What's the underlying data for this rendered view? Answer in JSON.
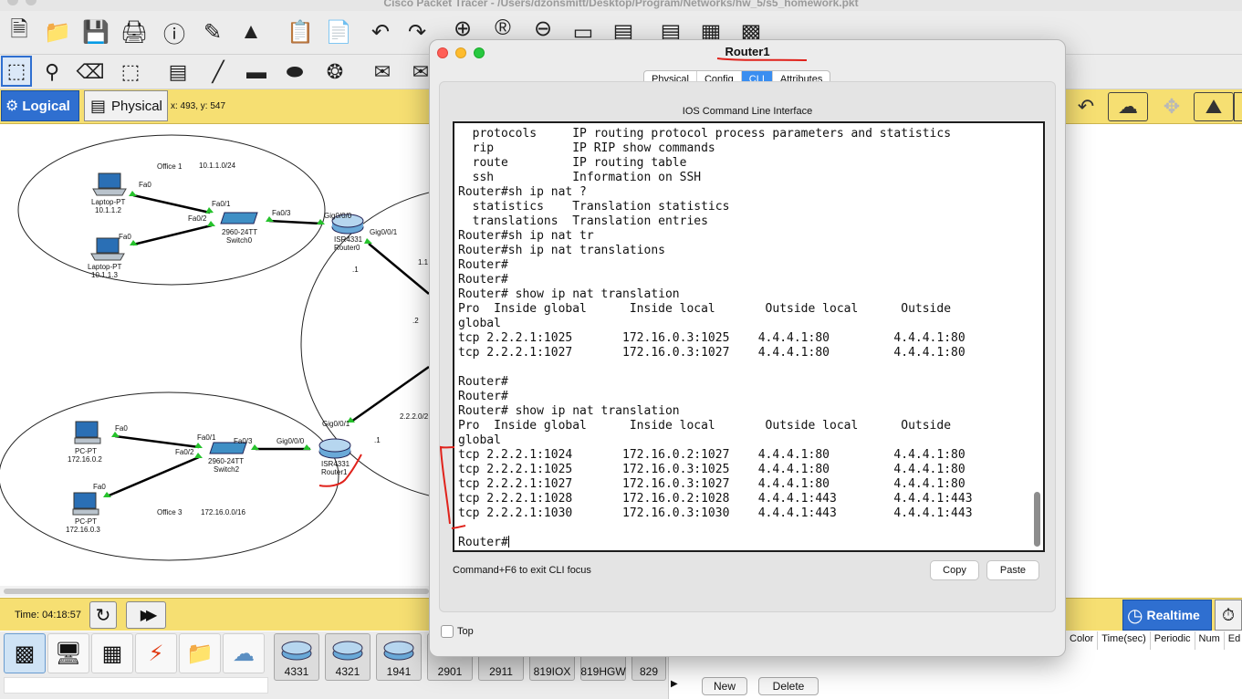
{
  "window": {
    "title": "Cisco Packet Tracer - /Users/dzonsmitt/Desktop/Program/Networks/hw_5/s5_homework.pkt"
  },
  "toolbar": {
    "main_icons": [
      "new-file-icon",
      "open-folder-icon",
      "save-icon",
      "print-icon",
      "info-icon",
      "network-wizard-icon",
      "activity-wizard-icon",
      "copy-icon",
      "paste-icon",
      "undo-icon",
      "redo-icon",
      "zoom-in-icon",
      "zoom-reset-icon",
      "zoom-out-icon",
      "drawing-palette-icon",
      "custom-device-icon",
      "cluster-icon",
      "viewport-icon"
    ],
    "edit_icons": [
      "select-icon",
      "inspect-icon",
      "delete-icon",
      "resize-icon",
      "note-icon",
      "line-icon",
      "rectangle-icon",
      "ellipse-icon",
      "freeform-icon",
      "simple-pdu-icon",
      "complex-pdu-icon"
    ]
  },
  "view_bar": {
    "logical_label": "Logical",
    "physical_label": "Physical",
    "coords": "x: 493, y: 547",
    "right_icons": [
      "back-icon",
      "cluster-cloud-icon",
      "move-object-icon",
      "set-background-icon"
    ]
  },
  "topology": {
    "office1": {
      "name": "Office 1",
      "subnet": "10.1.1.0/24"
    },
    "office3": {
      "name": "Office 3",
      "subnet": "172.16.0.0/16"
    },
    "laptops": [
      {
        "type": "Laptop-PT",
        "ip": "10.1.1.2",
        "port": "Fa0"
      },
      {
        "type": "Laptop-PT",
        "ip": "10.1.1.3",
        "port": "Fa0"
      }
    ],
    "pcs": [
      {
        "type": "PC-PT",
        "ip": "172.16.0.2",
        "port": "Fa0"
      },
      {
        "type": "PC-PT",
        "ip": "172.16.0.3",
        "port": "Fa0"
      }
    ],
    "switch0": {
      "model": "2960-24TT",
      "name": "Switch0",
      "ports": [
        "Fa0/1",
        "Fa0/2",
        "Fa0/3"
      ]
    },
    "switch2": {
      "model": "2960-24TT",
      "name": "Switch2",
      "ports": [
        "Fa0/1",
        "Fa0/2",
        "Fa0/3"
      ]
    },
    "router0": {
      "model": "ISR4331",
      "name": "Router0",
      "ports": [
        "Gig0/0/0",
        "Gig0/0/1"
      ]
    },
    "router1": {
      "model": "ISR4331",
      "name": "Router1",
      "ports": [
        "Gig0/0/0",
        "Gig0/0/1"
      ]
    },
    "link_labels": {
      "r0_dot1": ".1",
      "r0_dot2": ".2",
      "top_partial": "1.1",
      "wan": "2.2.2.0/2",
      "r1_dot1": ".1"
    }
  },
  "status_bar": {
    "time": "Time: 04:18:57",
    "realtime_label": "Realtime"
  },
  "pdu_table": {
    "headers": [
      "Color",
      "Time(sec)",
      "Periodic",
      "Num",
      "Ed"
    ],
    "new_label": "New",
    "delete_label": "Delete"
  },
  "palette": {
    "categories": [
      "network-devices-icon",
      "end-devices-icon",
      "components-icon",
      "connections-icon",
      "miscellaneous-icon",
      "multiuser-icon"
    ],
    "models": [
      "4331",
      "4321",
      "1941",
      "2901",
      "2911",
      "819IOX",
      "819HGW",
      "829"
    ]
  },
  "dialog": {
    "title": "Router1",
    "tabs": [
      "Physical",
      "Config",
      "CLI",
      "Attributes"
    ],
    "active_tab": "CLI",
    "section_label": "IOS Command Line Interface",
    "console_lines": [
      "  protocols     IP routing protocol process parameters and statistics",
      "  rip           IP RIP show commands",
      "  route         IP routing table",
      "  ssh           Information on SSH",
      "Router#sh ip nat ?",
      "  statistics    Translation statistics",
      "  translations  Translation entries",
      "Router#sh ip nat tr",
      "Router#sh ip nat translations",
      "Router#",
      "Router#",
      "Router# show ip nat translation",
      "Pro  Inside global      Inside local       Outside local      Outside",
      "global",
      "tcp 2.2.2.1:1025       172.16.0.3:1025    4.4.4.1:80         4.4.4.1:80",
      "tcp 2.2.2.1:1027       172.16.0.3:1027    4.4.4.1:80         4.4.4.1:80",
      "",
      "Router#",
      "Router#",
      "Router# show ip nat translation",
      "Pro  Inside global      Inside local       Outside local      Outside",
      "global",
      "tcp 2.2.2.1:1024       172.16.0.2:1027    4.4.4.1:80         4.4.4.1:80",
      "tcp 2.2.2.1:1025       172.16.0.3:1025    4.4.4.1:80         4.4.4.1:80",
      "tcp 2.2.2.1:1027       172.16.0.3:1027    4.4.4.1:80         4.4.4.1:80",
      "tcp 2.2.2.1:1028       172.16.0.2:1028    4.4.4.1:443        4.4.4.1:443",
      "tcp 2.2.2.1:1030       172.16.0.3:1030    4.4.4.1:443        4.4.4.1:443",
      "",
      "Router#"
    ],
    "focus_hint": "Command+F6 to exit CLI focus",
    "copy_label": "Copy",
    "paste_label": "Paste",
    "top_label": "Top"
  },
  "colors": {
    "accent_blue": "#3a8ef0",
    "mode_blue": "#2f6fd0",
    "yellow_bar": "#f6df72",
    "link_green": "#26c22c",
    "annotation_red": "#e0221b"
  }
}
